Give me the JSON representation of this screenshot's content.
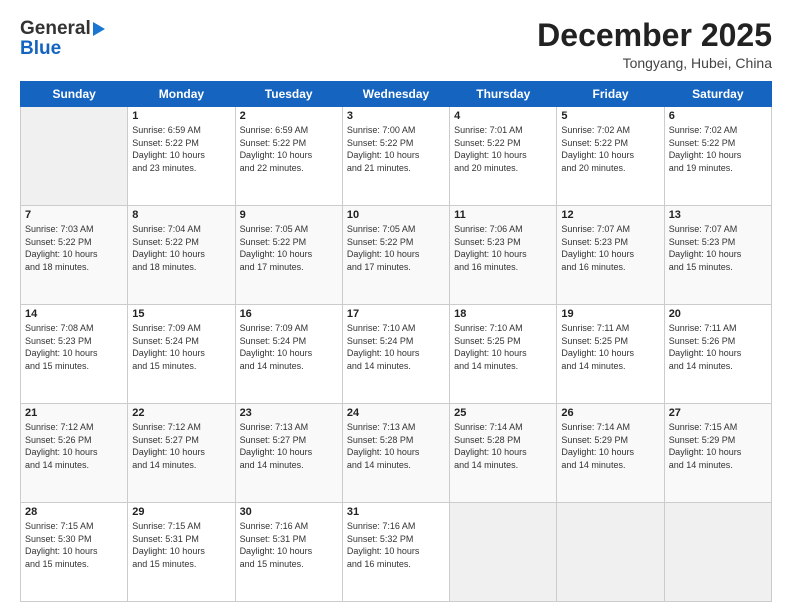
{
  "header": {
    "logo_general": "General",
    "logo_blue": "Blue",
    "month_title": "December 2025",
    "location": "Tongyang, Hubei, China"
  },
  "calendar": {
    "days_of_week": [
      "Sunday",
      "Monday",
      "Tuesday",
      "Wednesday",
      "Thursday",
      "Friday",
      "Saturday"
    ],
    "weeks": [
      [
        {
          "day": "",
          "info": ""
        },
        {
          "day": "1",
          "info": "Sunrise: 6:59 AM\nSunset: 5:22 PM\nDaylight: 10 hours\nand 23 minutes."
        },
        {
          "day": "2",
          "info": "Sunrise: 6:59 AM\nSunset: 5:22 PM\nDaylight: 10 hours\nand 22 minutes."
        },
        {
          "day": "3",
          "info": "Sunrise: 7:00 AM\nSunset: 5:22 PM\nDaylight: 10 hours\nand 21 minutes."
        },
        {
          "day": "4",
          "info": "Sunrise: 7:01 AM\nSunset: 5:22 PM\nDaylight: 10 hours\nand 20 minutes."
        },
        {
          "day": "5",
          "info": "Sunrise: 7:02 AM\nSunset: 5:22 PM\nDaylight: 10 hours\nand 20 minutes."
        },
        {
          "day": "6",
          "info": "Sunrise: 7:02 AM\nSunset: 5:22 PM\nDaylight: 10 hours\nand 19 minutes."
        }
      ],
      [
        {
          "day": "7",
          "info": "Sunrise: 7:03 AM\nSunset: 5:22 PM\nDaylight: 10 hours\nand 18 minutes."
        },
        {
          "day": "8",
          "info": "Sunrise: 7:04 AM\nSunset: 5:22 PM\nDaylight: 10 hours\nand 18 minutes."
        },
        {
          "day": "9",
          "info": "Sunrise: 7:05 AM\nSunset: 5:22 PM\nDaylight: 10 hours\nand 17 minutes."
        },
        {
          "day": "10",
          "info": "Sunrise: 7:05 AM\nSunset: 5:22 PM\nDaylight: 10 hours\nand 17 minutes."
        },
        {
          "day": "11",
          "info": "Sunrise: 7:06 AM\nSunset: 5:23 PM\nDaylight: 10 hours\nand 16 minutes."
        },
        {
          "day": "12",
          "info": "Sunrise: 7:07 AM\nSunset: 5:23 PM\nDaylight: 10 hours\nand 16 minutes."
        },
        {
          "day": "13",
          "info": "Sunrise: 7:07 AM\nSunset: 5:23 PM\nDaylight: 10 hours\nand 15 minutes."
        }
      ],
      [
        {
          "day": "14",
          "info": "Sunrise: 7:08 AM\nSunset: 5:23 PM\nDaylight: 10 hours\nand 15 minutes."
        },
        {
          "day": "15",
          "info": "Sunrise: 7:09 AM\nSunset: 5:24 PM\nDaylight: 10 hours\nand 15 minutes."
        },
        {
          "day": "16",
          "info": "Sunrise: 7:09 AM\nSunset: 5:24 PM\nDaylight: 10 hours\nand 14 minutes."
        },
        {
          "day": "17",
          "info": "Sunrise: 7:10 AM\nSunset: 5:24 PM\nDaylight: 10 hours\nand 14 minutes."
        },
        {
          "day": "18",
          "info": "Sunrise: 7:10 AM\nSunset: 5:25 PM\nDaylight: 10 hours\nand 14 minutes."
        },
        {
          "day": "19",
          "info": "Sunrise: 7:11 AM\nSunset: 5:25 PM\nDaylight: 10 hours\nand 14 minutes."
        },
        {
          "day": "20",
          "info": "Sunrise: 7:11 AM\nSunset: 5:26 PM\nDaylight: 10 hours\nand 14 minutes."
        }
      ],
      [
        {
          "day": "21",
          "info": "Sunrise: 7:12 AM\nSunset: 5:26 PM\nDaylight: 10 hours\nand 14 minutes."
        },
        {
          "day": "22",
          "info": "Sunrise: 7:12 AM\nSunset: 5:27 PM\nDaylight: 10 hours\nand 14 minutes."
        },
        {
          "day": "23",
          "info": "Sunrise: 7:13 AM\nSunset: 5:27 PM\nDaylight: 10 hours\nand 14 minutes."
        },
        {
          "day": "24",
          "info": "Sunrise: 7:13 AM\nSunset: 5:28 PM\nDaylight: 10 hours\nand 14 minutes."
        },
        {
          "day": "25",
          "info": "Sunrise: 7:14 AM\nSunset: 5:28 PM\nDaylight: 10 hours\nand 14 minutes."
        },
        {
          "day": "26",
          "info": "Sunrise: 7:14 AM\nSunset: 5:29 PM\nDaylight: 10 hours\nand 14 minutes."
        },
        {
          "day": "27",
          "info": "Sunrise: 7:15 AM\nSunset: 5:29 PM\nDaylight: 10 hours\nand 14 minutes."
        }
      ],
      [
        {
          "day": "28",
          "info": "Sunrise: 7:15 AM\nSunset: 5:30 PM\nDaylight: 10 hours\nand 15 minutes."
        },
        {
          "day": "29",
          "info": "Sunrise: 7:15 AM\nSunset: 5:31 PM\nDaylight: 10 hours\nand 15 minutes."
        },
        {
          "day": "30",
          "info": "Sunrise: 7:16 AM\nSunset: 5:31 PM\nDaylight: 10 hours\nand 15 minutes."
        },
        {
          "day": "31",
          "info": "Sunrise: 7:16 AM\nSunset: 5:32 PM\nDaylight: 10 hours\nand 16 minutes."
        },
        {
          "day": "",
          "info": ""
        },
        {
          "day": "",
          "info": ""
        },
        {
          "day": "",
          "info": ""
        }
      ]
    ]
  }
}
